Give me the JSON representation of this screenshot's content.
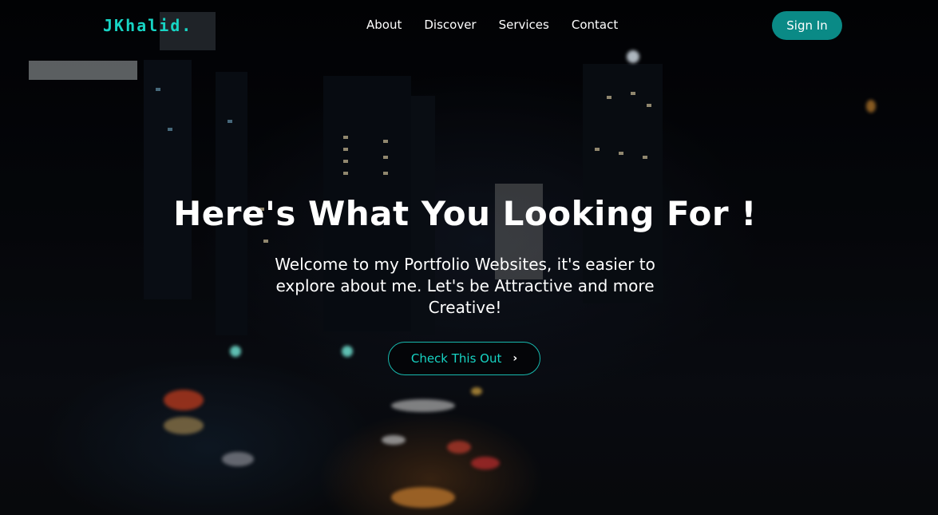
{
  "header": {
    "logo": "JKhalid.",
    "nav": [
      {
        "label": "About"
      },
      {
        "label": "Discover"
      },
      {
        "label": "Services"
      },
      {
        "label": "Contact"
      }
    ],
    "signin_label": "Sign In"
  },
  "hero": {
    "title": "Here's What You Looking For !",
    "subtitle": "Welcome to my Portfolio Websites, it's easier to explore about me. Let's be Attractive and more Creative!",
    "cta_label": "Check This Out",
    "cta_icon": "chevron-right-icon"
  },
  "colors": {
    "accent": "#17d4c4",
    "button_bg": "#0a8a86",
    "background": "#05070b"
  }
}
